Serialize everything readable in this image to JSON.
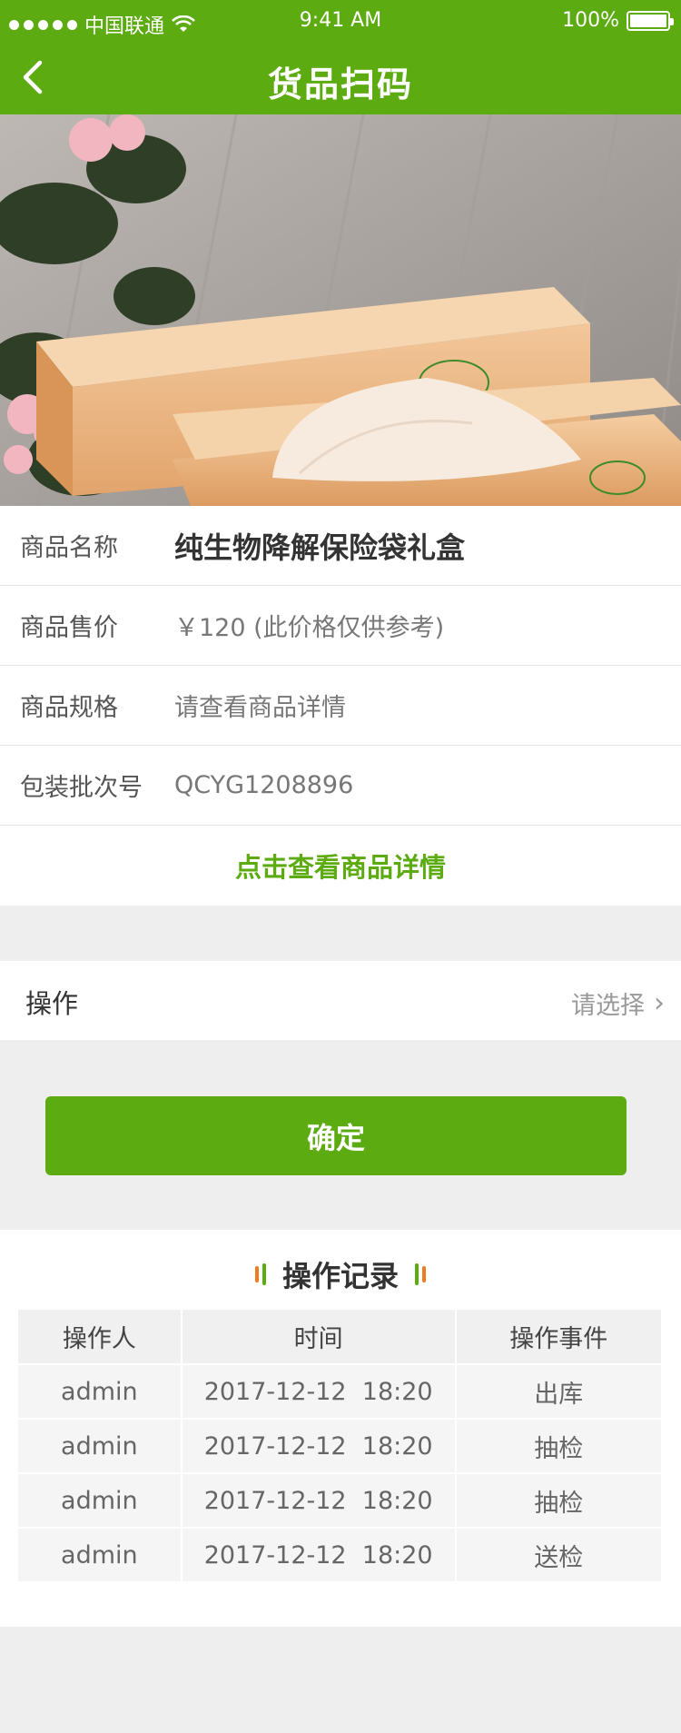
{
  "status_bar": {
    "carrier": "中国联通",
    "time": "9:41 AM",
    "battery": "100%"
  },
  "header": {
    "title": "货品扫码",
    "back_icon": "chevron-left-icon"
  },
  "product": {
    "name_label": "商品名称",
    "name_value": "纯生物降解保险袋礼盒",
    "price_label": "商品售价",
    "price_value": "￥120 (此价格仅供参考)",
    "spec_label": "商品规格",
    "spec_value": "请查看商品详情",
    "batch_label": "包装批次号",
    "batch_value": "QCYG1208896",
    "detail_link": "点击查看商品详情"
  },
  "operation": {
    "label": "操作",
    "placeholder": "请选择",
    "chevron": "›"
  },
  "confirm_label": "确定",
  "records": {
    "title": "操作记录",
    "columns": [
      "操作人",
      "时间",
      "操作事件"
    ],
    "rows": [
      [
        "admin",
        "2017-12-12  18:20",
        "出库"
      ],
      [
        "admin",
        "2017-12-12  18:20",
        "抽检"
      ],
      [
        "admin",
        "2017-12-12  18:20",
        "抽检"
      ],
      [
        "admin",
        "2017-12-12  18:20",
        "送检"
      ]
    ]
  },
  "colors": {
    "brand_green": "#5cab11",
    "accent_orange": "#f07b1e"
  }
}
